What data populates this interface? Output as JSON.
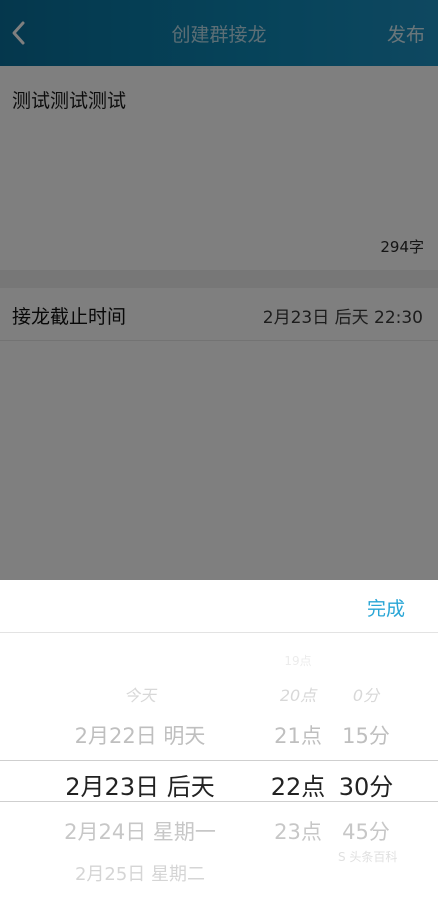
{
  "header": {
    "title": "创建群接龙",
    "publish_label": "发布",
    "back_icon": "chevron-left-icon"
  },
  "content": {
    "body_text": "测试测试测试",
    "char_count": "294字",
    "deadline": {
      "label": "接龙截止时间",
      "value": "2月23日 后天 22:30"
    }
  },
  "picker": {
    "done_label": "完成",
    "dates": {
      "partial": "今天",
      "prev": "2月22日 明天",
      "selected": "2月23日 后天",
      "next": "2月24日 星期一",
      "next2": "2月25日 星期二"
    },
    "hours": {
      "top": "19点",
      "partial": "20点",
      "prev": "21点",
      "selected": "22点",
      "next": "23点"
    },
    "minutes": {
      "partial": "0分",
      "prev": "15分",
      "selected": "30分",
      "next": "45分"
    }
  },
  "watermark": "S 头条百科",
  "colors": {
    "header_start": "#0a6f9a",
    "header_end": "#1d90c1",
    "accent": "#2aa6d6"
  }
}
